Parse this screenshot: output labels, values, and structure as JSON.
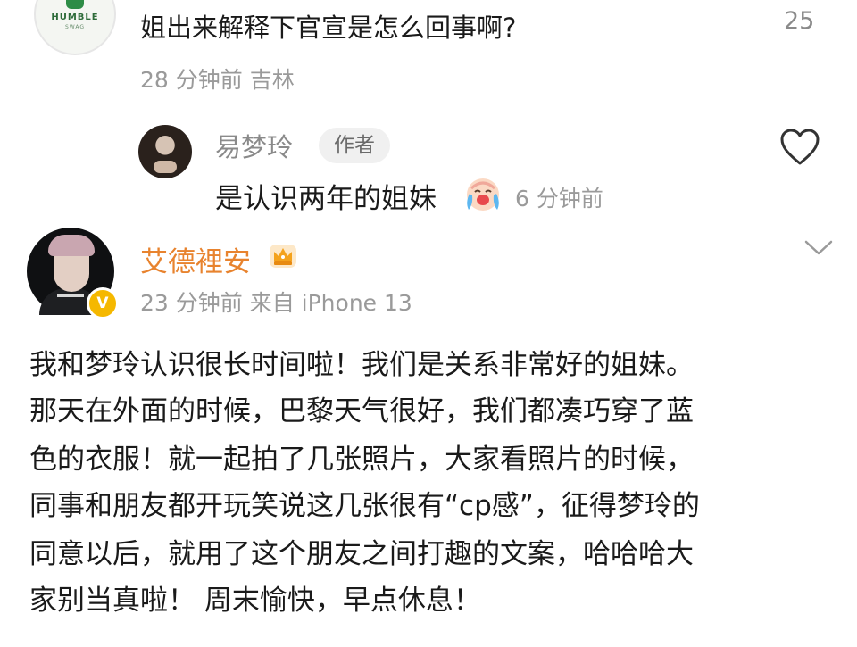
{
  "comment1": {
    "avatar_brand": "HUMBLE",
    "avatar_brand_sub": "SWAG",
    "text": "姐出来解释下官宣是怎么回事啊?",
    "like_count": "25",
    "meta": "28 分钟前 吉林"
  },
  "reply": {
    "author": "易梦玲",
    "badge": "作者",
    "text": "是认识两年的姐妹",
    "emoji": "crying-face-icon",
    "time": "6 分钟前"
  },
  "post": {
    "author": "艾德裡安",
    "verified_mark": "V",
    "meta": "23 分钟前  来自 iPhone 13",
    "lines": [
      "我和梦玲认识很长时间啦！我们是关系非常好的姐妹。",
      "那天在外面的时候，巴黎天气很好，我们都凑巧穿了蓝",
      "色的衣服！就一起拍了几张照片，大家看照片的时候，",
      "同事和朋友都开玩笑说这几张很有“cp感”，征得梦玲的",
      "同意以后，就用了这个朋友之间打趣的文案，哈哈哈大",
      "家别当真啦！ 周末愉快，早点休息！"
    ]
  },
  "colors": {
    "author_orange": "#e8832e",
    "meta_gray": "#9a9a9a",
    "verified_gold": "#f5b800"
  }
}
